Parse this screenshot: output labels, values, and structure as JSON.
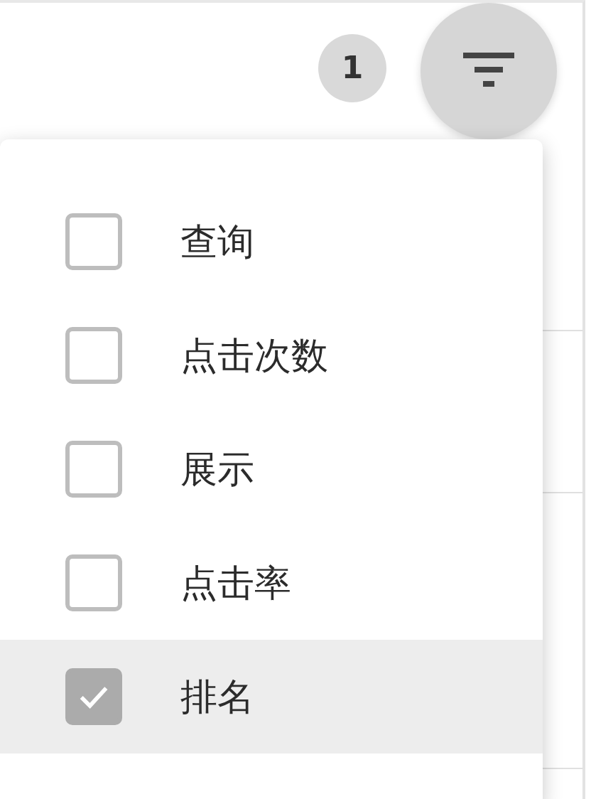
{
  "toolbar": {
    "filter_count": "1"
  },
  "filter_menu": {
    "items": [
      {
        "label": "查询",
        "checked": false,
        "selected": false
      },
      {
        "label": "点击次数",
        "checked": false,
        "selected": false
      },
      {
        "label": "展示",
        "checked": false,
        "selected": false
      },
      {
        "label": "点击率",
        "checked": false,
        "selected": false
      },
      {
        "label": "排名",
        "checked": true,
        "selected": true
      }
    ]
  }
}
